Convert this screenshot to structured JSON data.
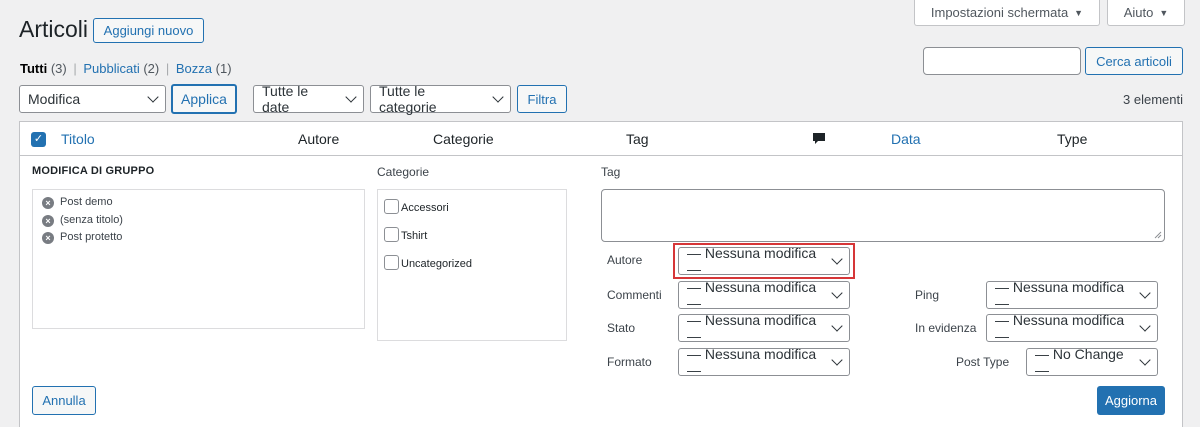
{
  "header": {
    "title": "Articoli",
    "add_new": "Aggiungi nuovo",
    "screen_options": "Impostazioni schermata",
    "help": "Aiuto"
  },
  "filters": {
    "all": "Tutti",
    "all_count": "(3)",
    "published": "Pubblicati",
    "published_count": "(2)",
    "draft": "Bozza",
    "draft_count": "(1)",
    "separator": "|"
  },
  "search": {
    "value": "",
    "button": "Cerca articoli"
  },
  "toolbar": {
    "bulk_action": "Modifica",
    "apply": "Applica",
    "dates": "Tutte le date",
    "categories": "Tutte le categorie",
    "filter": "Filtra",
    "count": "3 elementi"
  },
  "table": {
    "columns": {
      "title": "Titolo",
      "author": "Autore",
      "categories": "Categorie",
      "tags": "Tag",
      "date": "Data",
      "type": "Type"
    }
  },
  "bulk_edit": {
    "heading": "MODIFICA DI GRUPPO",
    "posts": [
      "Post demo",
      "(senza titolo)",
      "Post protetto"
    ],
    "categories_label": "Categorie",
    "categories": [
      "Accessori",
      "Tshirt",
      "Uncategorized"
    ],
    "tags_label": "Tag",
    "author_label": "Autore",
    "author_value": "— Nessuna modifica —",
    "comments_label": "Commenti",
    "comments_value": "— Nessuna modifica —",
    "status_label": "Stato",
    "status_value": "— Nessuna modifica —",
    "format_label": "Formato",
    "format_value": "— Nessuna modifica —",
    "ping_label": "Ping",
    "ping_value": "— Nessuna modifica —",
    "sticky_label": "In evidenza",
    "sticky_value": "— Nessuna modifica —",
    "post_type_label": "Post Type",
    "post_type_value": "— No Change —",
    "cancel": "Annulla",
    "update": "Aggiorna"
  },
  "colors": {
    "accent": "#2271b1",
    "highlight": "#d63638"
  }
}
